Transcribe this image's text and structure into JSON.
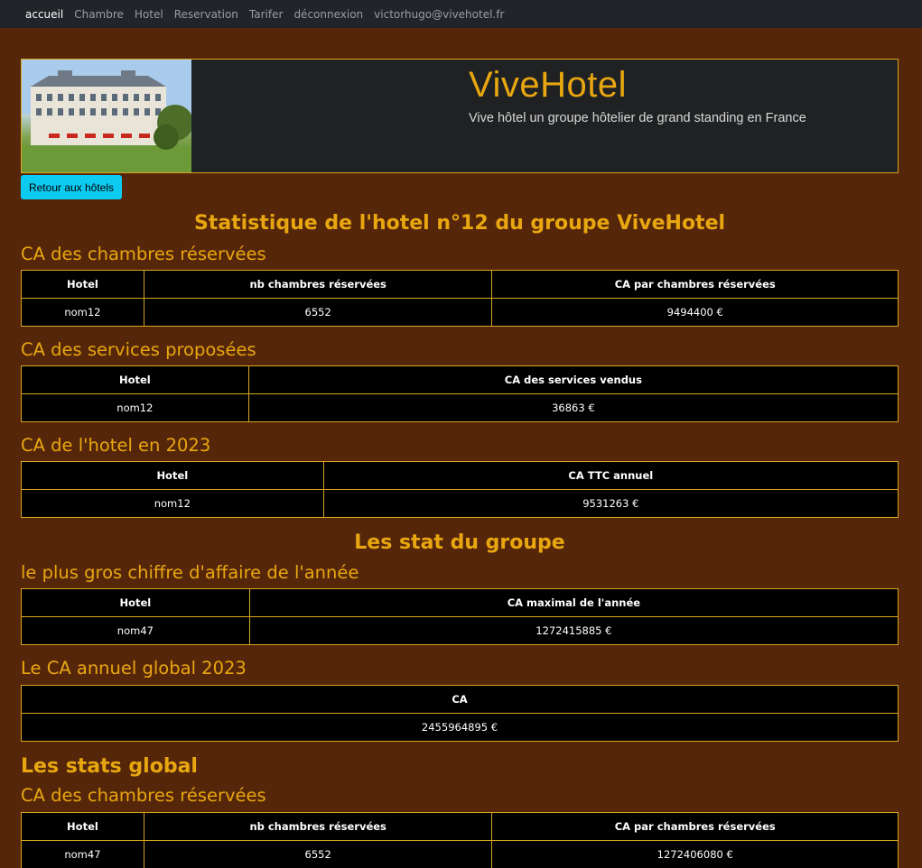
{
  "nav": {
    "items": [
      "accueil",
      "Chambre",
      "Hotel",
      "Reservation",
      "Tarifer",
      "déconnexion",
      "victorhugo@vivehotel.fr"
    ]
  },
  "hero": {
    "title": "ViveHotel",
    "subtitle": "Vive hôtel un groupe hôtelier de grand standing en France"
  },
  "back_button": "Retour aux hôtels",
  "stats_hotel": {
    "title": "Statistique de l'hotel n°12 du groupe ViveHotel",
    "rooms": {
      "title": "CA des chambres réservées",
      "headers": [
        "Hotel",
        "nb chambres réservées",
        "CA par chambres réservées"
      ],
      "row": [
        "nom12",
        "6552",
        "9494400 €"
      ]
    },
    "services": {
      "title": "CA des services proposées",
      "headers": [
        "Hotel",
        "CA des services vendus"
      ],
      "row": [
        "nom12",
        "36863 €"
      ]
    },
    "annual": {
      "title": "CA de l'hotel en 2023",
      "headers": [
        "Hotel",
        "CA TTC annuel"
      ],
      "row": [
        "nom12",
        "9531263 €"
      ]
    }
  },
  "stats_group": {
    "title": "Les stat du groupe",
    "max": {
      "title": "le plus gros chiffre d'affaire de l'année",
      "headers": [
        "Hotel",
        "CA maximal de l'année"
      ],
      "row": [
        "nom47",
        "1272415885 €"
      ]
    },
    "global": {
      "title": "Le CA annuel global 2023",
      "headers": [
        "CA"
      ],
      "row": [
        "2455964895 €"
      ]
    }
  },
  "stats_global": {
    "title": "Les stats global",
    "rooms": {
      "title": "CA des chambres réservées",
      "headers": [
        "Hotel",
        "nb chambres réservées",
        "CA par chambres réservées"
      ],
      "row": [
        "nom47",
        "6552",
        "1272406080 €"
      ]
    }
  }
}
